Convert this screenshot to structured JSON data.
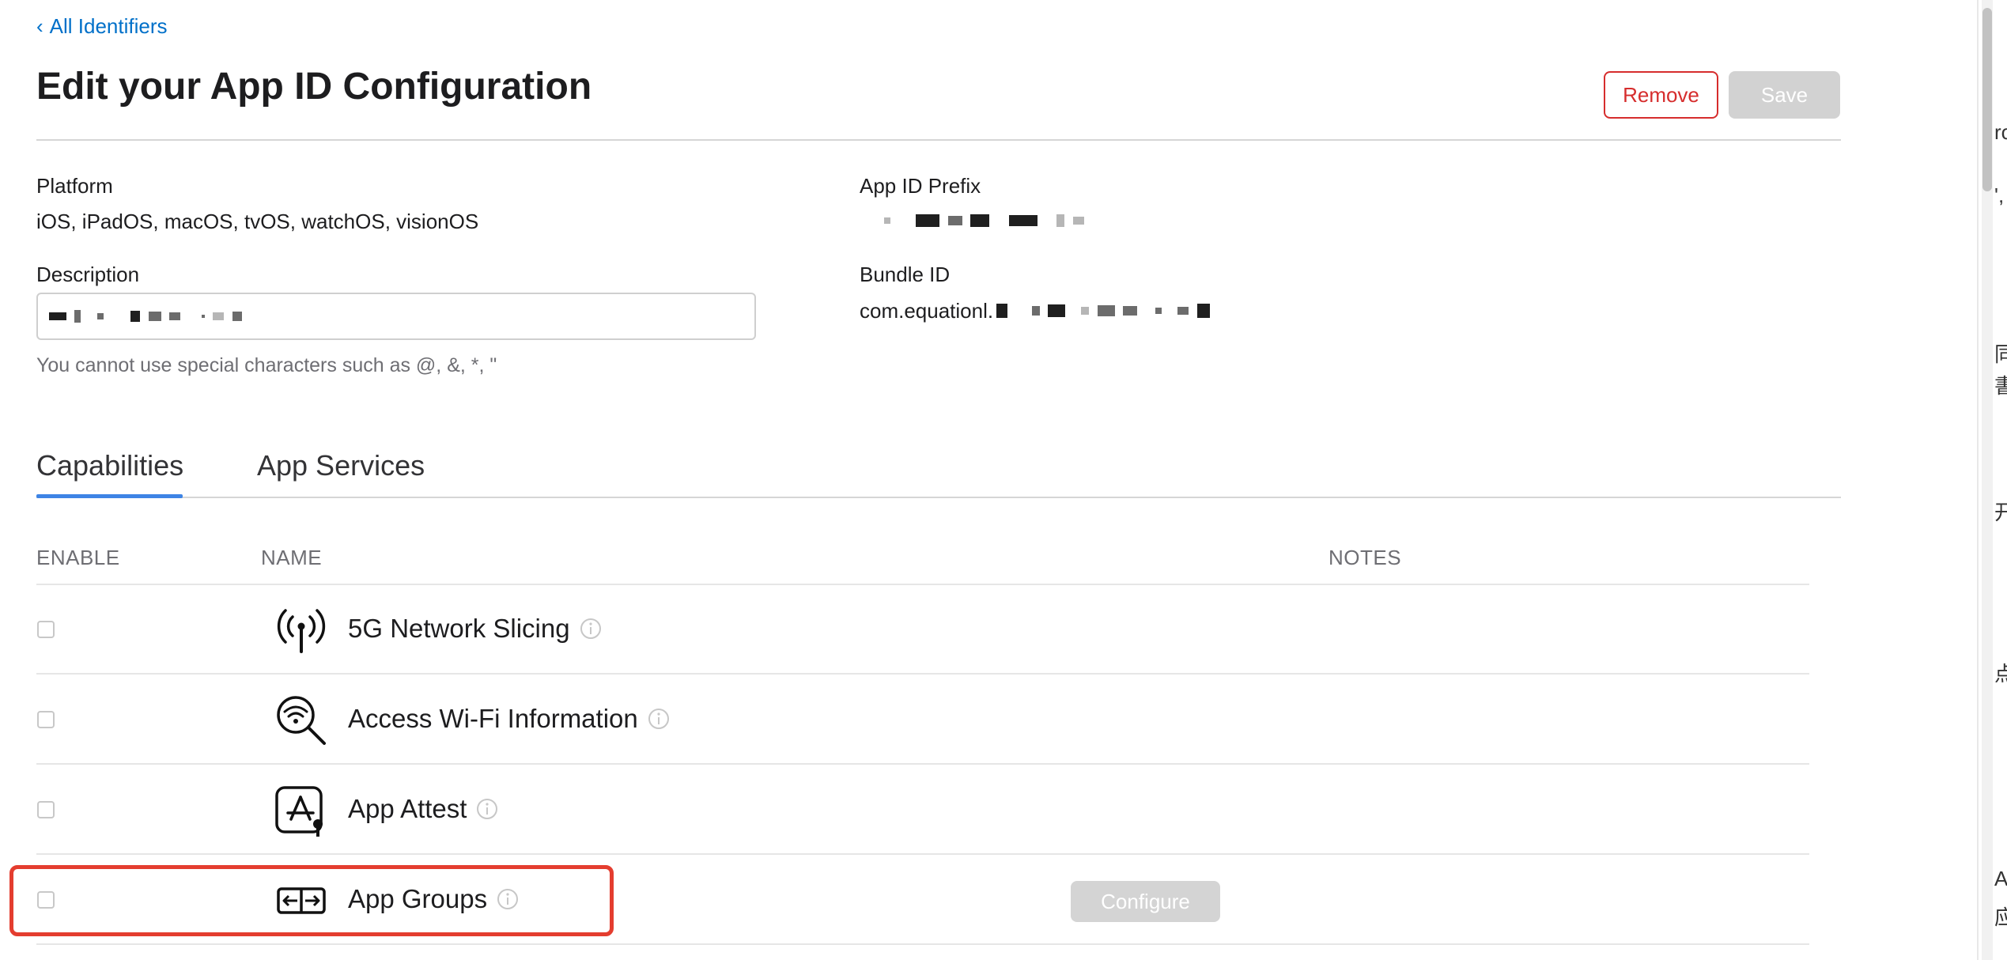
{
  "nav": {
    "back_label": "All Identifiers",
    "back_chevron": "‹"
  },
  "page": {
    "title": "Edit your App ID Configuration"
  },
  "actions": {
    "remove_label": "Remove",
    "save_label": "Save"
  },
  "fields": {
    "platform_label": "Platform",
    "platform_value": "iOS, iPadOS, macOS, tvOS, watchOS, visionOS",
    "prefix_label": "App ID Prefix",
    "description_label": "Description",
    "description_helper": "You cannot use special characters such as @, &, *, \"",
    "bundle_label": "Bundle ID",
    "bundle_value_prefix": "com.equationl."
  },
  "tabs": [
    {
      "label": "Capabilities",
      "active": true
    },
    {
      "label": "App Services",
      "active": false
    }
  ],
  "table": {
    "headers": {
      "enable": "ENABLE",
      "name": "NAME",
      "notes": "NOTES"
    },
    "rows": [
      {
        "name": "5G Network Slicing",
        "icon": "antenna-icon",
        "enabled": false
      },
      {
        "name": "Access Wi-Fi Information",
        "icon": "wifi-search-icon",
        "enabled": false
      },
      {
        "name": "App Attest",
        "icon": "app-attest-icon",
        "enabled": false
      },
      {
        "name": "App Groups",
        "icon": "app-groups-icon",
        "enabled": false,
        "action": "Configure",
        "highlighted": true
      }
    ]
  },
  "colors": {
    "accent": "#0070c9",
    "danger": "#d62d2d",
    "tab_active": "#3e84e5",
    "highlight": "#e43d2f",
    "disabled_button": "#d2d2d2"
  },
  "right_edge_glyphs": [
    "ro",
    "',",
    "同",
    "書",
    "开",
    "点",
    "A",
    "应"
  ]
}
